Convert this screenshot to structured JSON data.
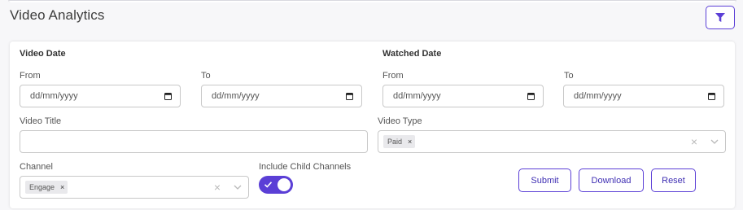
{
  "page": {
    "title": "Video Analytics"
  },
  "filters": {
    "video_date": {
      "label": "Video Date",
      "from_label": "From",
      "to_label": "To",
      "from_placeholder": "dd/mm/yyyy",
      "to_placeholder": "dd/mm/yyyy"
    },
    "watched_date": {
      "label": "Watched Date",
      "from_label": "From",
      "to_label": "To",
      "from_placeholder": "dd/mm/yyyy",
      "to_placeholder": "dd/mm/yyyy"
    },
    "video_title": {
      "label": "Video Title",
      "value": ""
    },
    "video_type": {
      "label": "Video Type",
      "selected": [
        "Paid"
      ]
    },
    "channel": {
      "label": "Channel",
      "selected": [
        "Engage"
      ]
    },
    "include_child_channels": {
      "label": "Include Child Channels",
      "checked": true
    }
  },
  "actions": {
    "submit": "Submit",
    "download": "Download",
    "reset": "Reset"
  },
  "icons": {
    "filter": "filter-icon",
    "calendar": "calendar-icon",
    "clear": "close-icon",
    "dropdown": "chevron-down-icon",
    "check": "check-icon"
  },
  "colors": {
    "accent": "#5b3fd6",
    "accent_text": "#3f2fb3"
  }
}
